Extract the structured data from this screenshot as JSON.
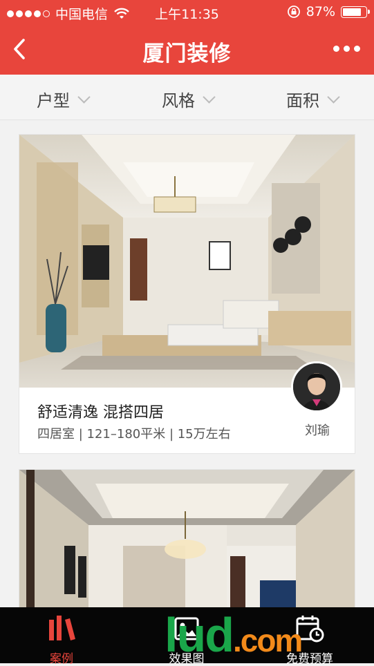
{
  "status_bar": {
    "carrier": "中国电信",
    "time": "上午11:35",
    "battery": "87%",
    "battery_level": 0.87
  },
  "nav": {
    "title": "厦门装修",
    "back_icon": "chevron-left-icon",
    "more_icon": "more-dots-icon"
  },
  "filters": [
    {
      "label": "户型"
    },
    {
      "label": "风格"
    },
    {
      "label": "面积"
    }
  ],
  "cards": [
    {
      "title": "舒适清逸 混搭四居",
      "meta": "四居室 | 121–180平米 | 15万左右",
      "designer": "刘瑜"
    },
    {
      "title": "",
      "meta": "",
      "designer": ""
    }
  ],
  "tabs": [
    {
      "label": "案例",
      "icon": "case-icon",
      "active": true
    },
    {
      "label": "效果图",
      "icon": "gallery-icon",
      "active": false
    },
    {
      "label": "免费预算",
      "icon": "calendar-clock-icon",
      "active": false
    }
  ],
  "watermark": {
    "text_a": "lud",
    "text_b": ".com"
  },
  "colors": {
    "primary": "#e8453c",
    "tabbar": "#060606",
    "active_tab": "#e8453c",
    "watermark_green": "#1aa64a",
    "watermark_orange": "#f28a1a"
  }
}
